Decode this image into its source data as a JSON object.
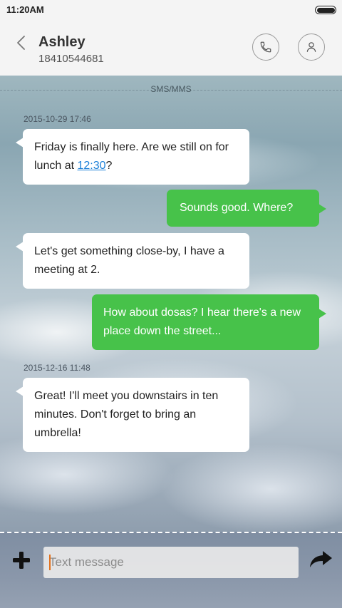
{
  "status_bar": {
    "time": "11:20AM",
    "battery_level": 1.0
  },
  "header": {
    "contact_name": "Ashley",
    "contact_number": "18410544681"
  },
  "conversation": {
    "channel_label": "SMS/MMS",
    "timestamps": [
      "2015-10-29 17:46",
      "2015-12-16 11:48"
    ],
    "messages": [
      {
        "direction": "incoming",
        "parts": [
          "Friday is finally here. Are we still on for lunch at ",
          "12:30",
          "?"
        ]
      },
      {
        "direction": "outgoing",
        "text": "Sounds good. Where?"
      },
      {
        "direction": "incoming",
        "text": "Let's get something close-by, I have a meeting at 2."
      },
      {
        "direction": "outgoing",
        "text": "How about dosas? I hear there's a new place down the street..."
      },
      {
        "direction": "incoming",
        "text": "Great! I'll meet you downstairs in ten minutes. Don't forget to bring an umbrella!"
      }
    ]
  },
  "composer": {
    "placeholder": "Text message",
    "value": ""
  },
  "icons": {
    "back": "chevron-left-icon",
    "call": "phone-icon",
    "profile": "person-icon",
    "add": "plus-icon",
    "send": "forward-arrow-icon"
  },
  "colors": {
    "outgoing_bubble": "#47c24a",
    "incoming_bubble": "#ffffff",
    "link": "#1a7fd8",
    "caret": "#e2711d"
  }
}
